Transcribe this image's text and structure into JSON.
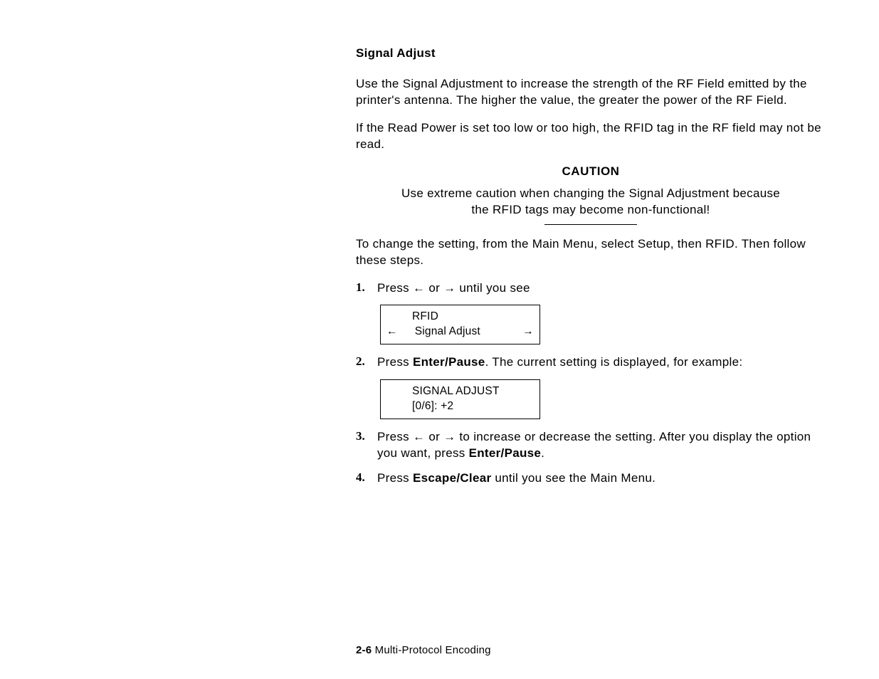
{
  "heading": "Signal Adjust",
  "para1": "Use the Signal Adjustment to increase the strength of the RF Field emitted by the printer's antenna.  The higher the value, the greater the power of the RF Field.",
  "para2": "If the Read Power is set too low or too high, the RFID tag in the RF field may not be read.",
  "cautionLabel": "CAUTION",
  "cautionText": "Use extreme caution when changing the Signal Adjustment because the RFID tags may become non-functional!",
  "para3": "To change the setting, from the Main Menu, select Setup, then RFID.  Then follow these steps.",
  "step1": {
    "num": "1.",
    "pre": "Press ",
    "mid": " or ",
    "post": " until you see"
  },
  "display1": {
    "line1": "RFID",
    "leftArrow": "←",
    "center": "Signal Adjust",
    "rightArrow": "→"
  },
  "step2": {
    "num": "2.",
    "pre": "Press ",
    "bold": "Enter/Pause",
    "post": ".  The current setting is displayed, for example:"
  },
  "display2": {
    "line1": "SIGNAL ADJUST",
    "line2": "[0/6]:  +2"
  },
  "step3": {
    "num": "3.",
    "pre": "Press ",
    "mid": " or ",
    "post1": " to increase or decrease the setting.  After you display the option you want, press ",
    "bold": "Enter/Pause",
    "post2": "."
  },
  "step4": {
    "num": "4.",
    "pre": "Press ",
    "bold": "Escape/Clear",
    "post": " until you see the Main Menu."
  },
  "arrows": {
    "left": "←",
    "right": "→"
  },
  "footer": {
    "num": "2-6",
    "text": "  Multi-Protocol Encoding"
  }
}
